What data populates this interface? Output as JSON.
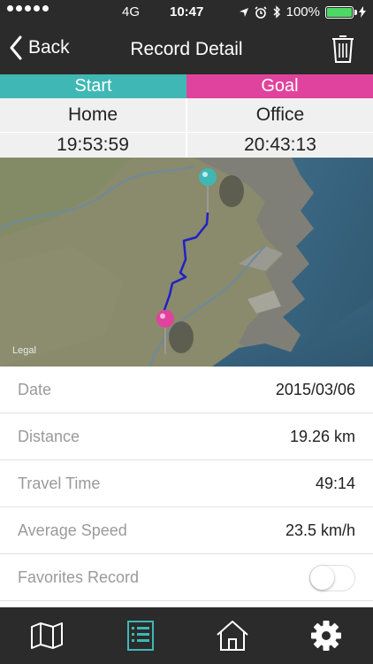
{
  "status_bar": {
    "carrier": "4G",
    "time": "10:47",
    "battery_percent": "100%",
    "battery_level": 1.0,
    "battery_color": "#4cd964"
  },
  "navbar": {
    "back_label": "Back",
    "title": "Record Detail",
    "trash_icon": "trash-icon"
  },
  "route": {
    "start_label": "Start",
    "goal_label": "Goal",
    "start_color": "#3fb7b5",
    "goal_color": "#e0439d",
    "start_place": "Home",
    "goal_place": "Office",
    "start_time": "19:53:59",
    "goal_time": "20:43:13"
  },
  "map": {
    "legal_label": "Legal",
    "route_color": "#2020c8"
  },
  "details": {
    "date_label": "Date",
    "date_value": "2015/03/06",
    "distance_label": "Distance",
    "distance_value": "19.26 km",
    "travel_time_label": "Travel Time",
    "travel_time_value": "49:14",
    "avg_speed_label": "Average Speed",
    "avg_speed_value": "23.5 km/h",
    "favorites_label": "Favorites Record",
    "favorites_on": false
  },
  "tabbar": {
    "items": [
      {
        "icon": "map-icon",
        "active": false
      },
      {
        "icon": "list-icon",
        "active": true
      },
      {
        "icon": "home-icon",
        "active": false
      },
      {
        "icon": "gear-icon",
        "active": false
      }
    ],
    "active_color": "#3fb7b5"
  }
}
